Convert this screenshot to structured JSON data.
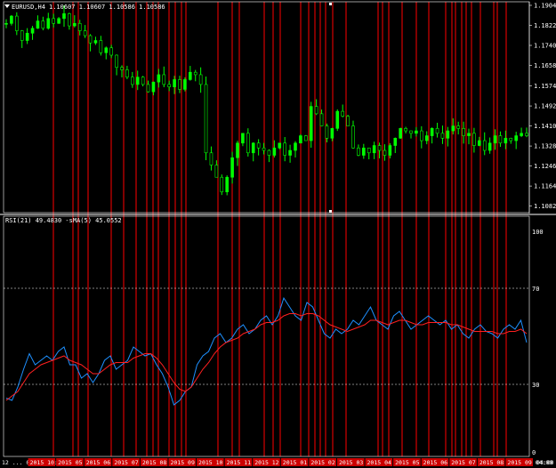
{
  "main_chart": {
    "symbol_label": "EURUSD,H4",
    "ohlc_label": "1.10607 1.10607 1.10586 1.10586",
    "price_ticks": [
      "1.19040",
      "1.18220",
      "1.17400",
      "1.16580",
      "1.15740",
      "1.14920",
      "1.14100",
      "1.13280",
      "1.12460",
      "1.11640",
      "1.10820"
    ],
    "last_price": "1.10586"
  },
  "indicator": {
    "label": "RSI(21) 49.4830 -sMA(5) 45.0552",
    "levels": [
      "100",
      "70",
      "30",
      "0"
    ]
  },
  "time_axis": {
    "labels": [
      "12 ... 00:00",
      "2015 10:00",
      "2015 05 08:00",
      "2015 06 20:00",
      "2015 07 12:00",
      "2015 08 00:00",
      "2015 09 12:00",
      "2015 10 00:00",
      "2015 11 04:00",
      "2015 12 00:00",
      "2015 01 08:00",
      "2015 02 12:00",
      "2015 03 04:00",
      "2015 04 20:00",
      "2015 05 12:00",
      "2015 06 04:00",
      "2015 07 20:00",
      "2015 08 12:00",
      "2015 09 04:00"
    ],
    "corner": "04:00"
  },
  "colors": {
    "background": "#000000",
    "bull_candle": "#00ff00",
    "bear_candle": "#000000",
    "rsi_line": "#1e90ff",
    "sma_line": "#ff2020",
    "vlines": "#ff0000",
    "axis": "#ffffff",
    "time_band": "#cc0000"
  },
  "chart_data": {
    "type": "line",
    "price_ylim": [
      1.1066,
      1.1904
    ],
    "rsi_ylim": [
      0,
      100
    ],
    "price": [
      1.183,
      1.186,
      1.18,
      1.176,
      1.179,
      1.181,
      1.184,
      1.181,
      1.185,
      1.183,
      1.185,
      1.187,
      1.182,
      1.183,
      1.18,
      1.178,
      1.175,
      1.176,
      1.171,
      1.173,
      1.17,
      1.165,
      1.164,
      1.161,
      1.158,
      1.161,
      1.158,
      1.155,
      1.159,
      1.162,
      1.158,
      1.157,
      1.16,
      1.156,
      1.16,
      1.163,
      1.162,
      1.158,
      1.13,
      1.125,
      1.12,
      1.114,
      1.12,
      1.128,
      1.134,
      1.138,
      1.13,
      1.134,
      1.132,
      1.131,
      1.129,
      1.132,
      1.134,
      1.129,
      1.131,
      1.134,
      1.137,
      1.135,
      1.149,
      1.146,
      1.141,
      1.136,
      1.14,
      1.147,
      1.145,
      1.141,
      1.132,
      1.129,
      1.132,
      1.13,
      1.133,
      1.131,
      1.129,
      1.133,
      1.136,
      1.14,
      1.139,
      1.138,
      1.139,
      1.135,
      1.137,
      1.14,
      1.138,
      1.136,
      1.139,
      1.141,
      1.14,
      1.137,
      1.138,
      1.133,
      1.135,
      1.131,
      1.134,
      1.137,
      1.134,
      1.136,
      1.135,
      1.137,
      1.138,
      1.137
    ],
    "rsi": [
      25,
      24,
      30,
      38,
      45,
      40,
      42,
      44,
      42,
      46,
      48,
      40,
      40,
      34,
      36,
      32,
      36,
      42,
      44,
      38,
      40,
      42,
      48,
      46,
      44,
      45,
      40,
      36,
      30,
      22,
      24,
      28,
      30,
      40,
      44,
      46,
      52,
      54,
      50,
      52,
      56,
      58,
      54,
      56,
      60,
      62,
      58,
      62,
      70,
      66,
      62,
      60,
      68,
      66,
      60,
      54,
      52,
      56,
      54,
      56,
      60,
      58,
      62,
      66,
      60,
      58,
      56,
      62,
      64,
      60,
      56,
      58,
      60,
      62,
      60,
      58,
      60,
      56,
      58,
      54,
      52,
      56,
      58,
      55,
      54,
      52,
      56,
      58,
      56,
      60,
      50
    ],
    "sma": [
      24,
      26,
      28,
      32,
      36,
      38,
      40,
      41,
      42,
      43,
      44,
      42,
      41,
      40,
      38,
      36,
      36,
      38,
      40,
      41,
      41,
      41,
      43,
      44,
      45,
      45,
      43,
      40,
      36,
      32,
      29,
      28,
      30,
      34,
      38,
      41,
      45,
      48,
      50,
      51,
      52,
      54,
      55,
      56,
      58,
      59,
      59,
      60,
      62,
      63,
      63,
      62,
      63,
      63,
      62,
      60,
      58,
      57,
      56,
      55,
      56,
      57,
      58,
      60,
      60,
      59,
      58,
      59,
      60,
      60,
      59,
      58,
      58,
      59,
      59,
      59,
      59,
      58,
      58,
      57,
      56,
      55,
      55,
      55,
      55,
      54,
      54,
      55,
      55,
      56,
      54
    ]
  }
}
